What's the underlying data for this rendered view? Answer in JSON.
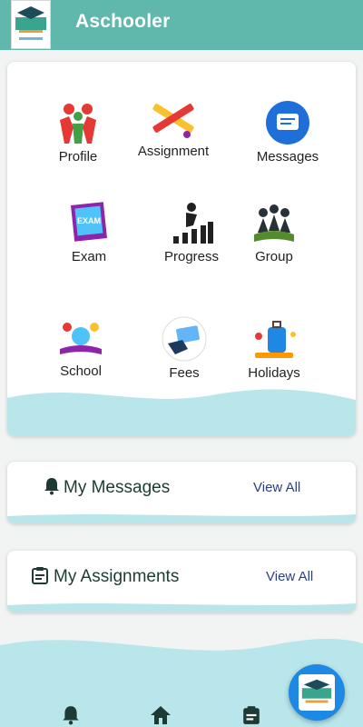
{
  "app": {
    "title": "Aschooler"
  },
  "grid": {
    "items": [
      {
        "label": "Profile",
        "icon": "family-icon"
      },
      {
        "label": "Assignment",
        "icon": "pencil-brush-icon"
      },
      {
        "label": "Messages",
        "icon": "message-bubble-icon"
      },
      {
        "label": "Exam",
        "icon": "exam-paper-icon"
      },
      {
        "label": "Progress",
        "icon": "progress-stairs-icon"
      },
      {
        "label": "Group",
        "icon": "group-book-icon"
      },
      {
        "label": "School",
        "icon": "school-globe-icon"
      },
      {
        "label": "Fees",
        "icon": "card-payment-icon"
      },
      {
        "label": "Holidays",
        "icon": "luggage-icon"
      }
    ]
  },
  "messages_section": {
    "title": "My Messages",
    "view_all": "View All",
    "icon": "bell-icon"
  },
  "assignments_section": {
    "title": "My Assignments",
    "view_all": "View All",
    "icon": "clipboard-icon"
  },
  "bottom_nav": [
    {
      "icon": "bell-icon"
    },
    {
      "icon": "home-icon"
    },
    {
      "icon": "clipboard-icon"
    }
  ],
  "colors": {
    "appbar": "#5fb8ab",
    "wave": "#b9e6ea",
    "accent": "#1e88e5",
    "link": "#2b3f86"
  }
}
